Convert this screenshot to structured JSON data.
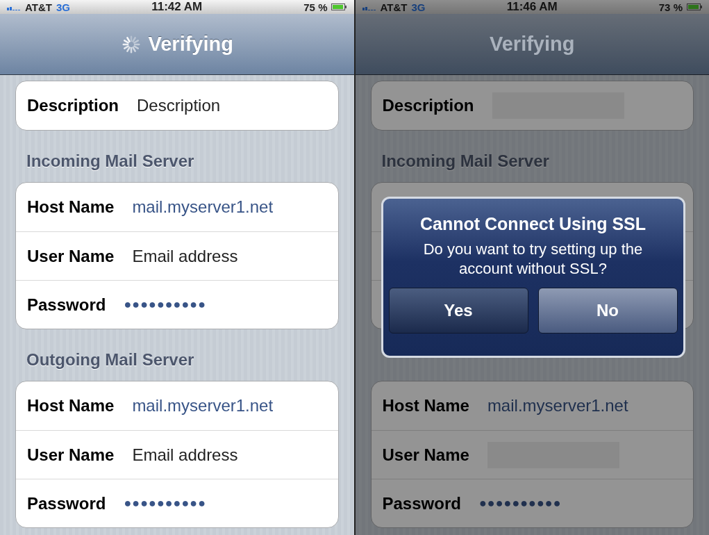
{
  "screens": [
    {
      "dimmed": false,
      "status_bar": {
        "carrier": "AT&T",
        "network": "3G",
        "time": "11:42 AM",
        "battery": "75 %"
      },
      "nav_bar": {
        "title": "Verifying",
        "spinner": true
      },
      "sections": [
        {
          "rows": [
            {
              "kind": "plain",
              "label": "Description",
              "value": "Description"
            }
          ]
        },
        {
          "header": "Incoming Mail Server",
          "rows": [
            {
              "kind": "link",
              "label": "Host Name",
              "value": "mail.myserver1.net"
            },
            {
              "kind": "plain",
              "label": "User Name",
              "value": "Email address"
            },
            {
              "kind": "secret",
              "label": "Password",
              "value": "●●●●●●●●●●"
            }
          ]
        },
        {
          "header": "Outgoing Mail Server",
          "rows": [
            {
              "kind": "link",
              "label": "Host Name",
              "value": "mail.myserver1.net"
            },
            {
              "kind": "plain",
              "label": "User Name",
              "value": "Email address"
            },
            {
              "kind": "secret",
              "label": "Password",
              "value": "●●●●●●●●●●"
            }
          ]
        }
      ]
    },
    {
      "dimmed": true,
      "status_bar": {
        "carrier": "AT&T",
        "network": "3G",
        "time": "11:46 AM",
        "battery": "73 %"
      },
      "nav_bar": {
        "title": "Verifying",
        "spinner": false
      },
      "sections": [
        {
          "rows": [
            {
              "kind": "redacted",
              "label": "Description"
            }
          ]
        },
        {
          "header": "Incoming Mail Server",
          "rows": [
            {
              "kind": "covered"
            },
            {
              "kind": "covered"
            },
            {
              "kind": "covered"
            }
          ]
        },
        {
          "rows": [
            {
              "kind": "link",
              "label": "Host Name",
              "value": "mail.myserver1.net"
            },
            {
              "kind": "redacted",
              "label": "User Name"
            },
            {
              "kind": "secret",
              "label": "Password",
              "value": "●●●●●●●●●●"
            }
          ]
        }
      ],
      "dialog": {
        "title": "Cannot Connect Using SSL",
        "message": "Do you want to try setting up the account without SSL?",
        "buttons": [
          {
            "label": "Yes",
            "default": false
          },
          {
            "label": "No",
            "default": true
          }
        ]
      }
    }
  ]
}
